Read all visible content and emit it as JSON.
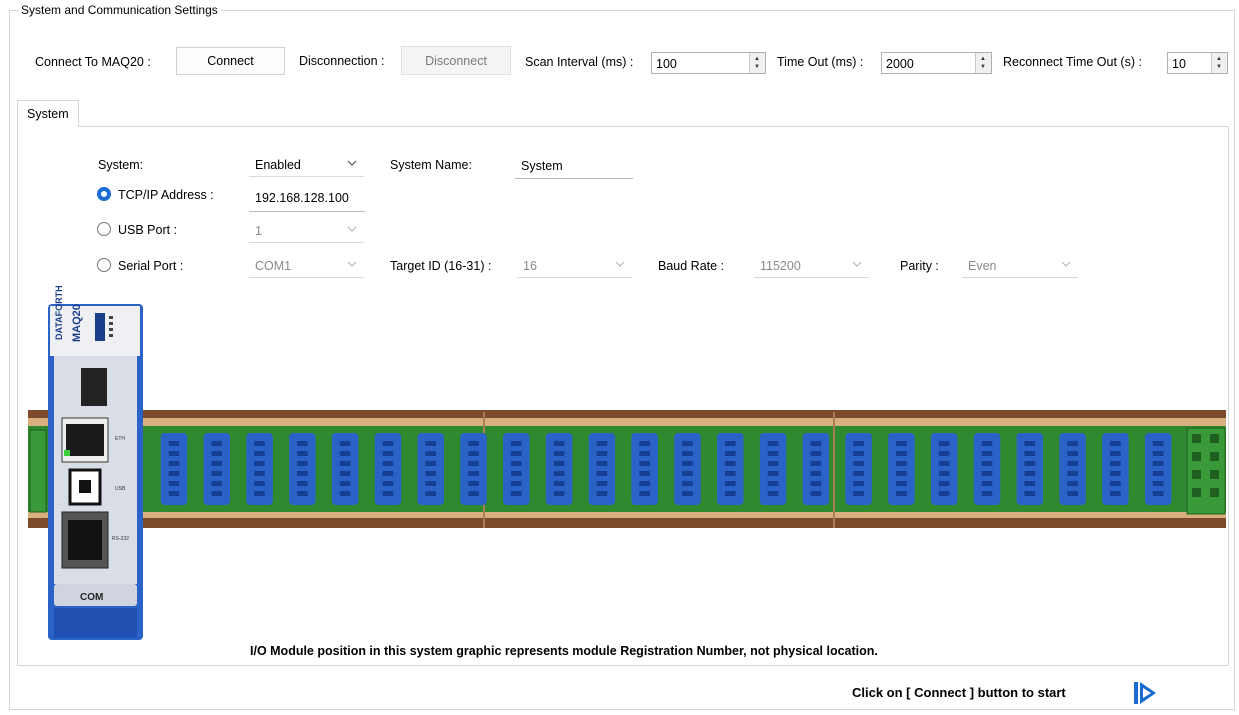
{
  "group": {
    "title": "System and Communication Settings"
  },
  "connection_bar": {
    "connect_label": "Connect To MAQ20 :",
    "connect_button": "Connect",
    "disconnect_label": "Disconnection :",
    "disconnect_button": "Disconnect",
    "scan_interval_label": "Scan Interval (ms) :",
    "scan_interval_value": "100",
    "timeout_label": "Time Out (ms) :",
    "timeout_value": "2000",
    "reconnect_label": "Reconnect Time Out (s) :",
    "reconnect_value": "10"
  },
  "tabs": [
    {
      "label": "System"
    }
  ],
  "system_form": {
    "system_label": "System:",
    "system_value": "Enabled",
    "system_name_label": "System Name:",
    "system_name_value": "System",
    "tcp_label": "TCP/IP Address :",
    "tcp_value": "192.168.128.100",
    "usb_label": "USB Port :",
    "usb_value": "1",
    "serial_label": "Serial  Port :",
    "serial_value": "COM1",
    "target_label": "Target ID (16-31) :",
    "target_value": "16",
    "baud_label": "Baud Rate :",
    "baud_value": "115200",
    "parity_label": "Parity :",
    "parity_value": "Even",
    "selected_interface": "tcp"
  },
  "graphic": {
    "com_module_label": "COM",
    "brand_text": "DATAFORTH",
    "model_text": "MAQ20",
    "port_labels": [
      "ETH",
      "USB",
      "RS-232"
    ],
    "slot_count": 24,
    "colors": {
      "module_blue": "#2a62c8",
      "backplane_green": "#2f8a2f",
      "rail_brown": "#7a4a2a",
      "radio_blue": "#1b6bd0"
    }
  },
  "notice": "I/O Module position in this system graphic represents module Registration Number, not physical location.",
  "footer": {
    "start_message": "Click on [ Connect ] button to start",
    "start_icon": "play-forward-icon"
  }
}
